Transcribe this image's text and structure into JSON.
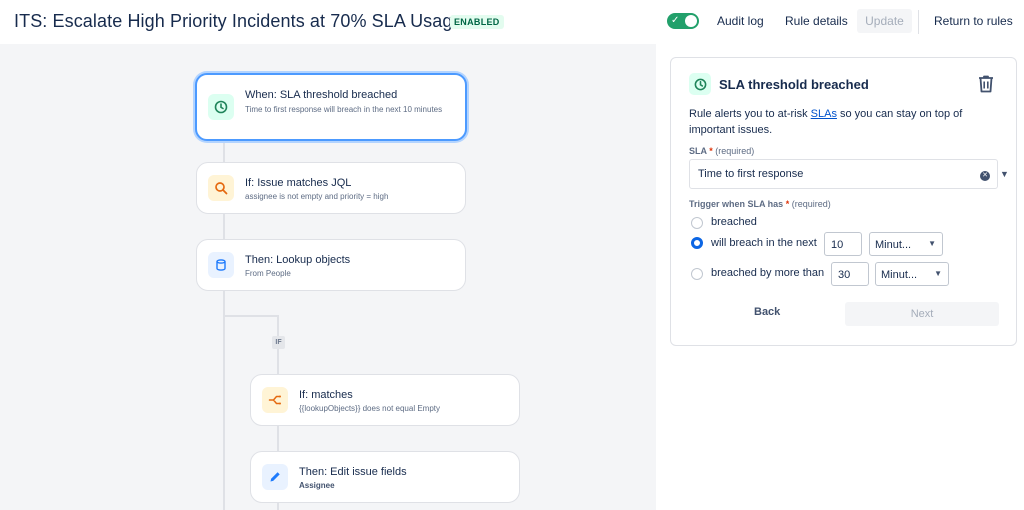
{
  "header": {
    "title": "ITS: Escalate High Priority Incidents at 70% SLA Usage",
    "status_badge": "ENABLED",
    "audit_log": "Audit log",
    "rule_details": "Rule details",
    "update": "Update",
    "return_to_rules": "Return to rules",
    "toggle_enabled": true
  },
  "flow": {
    "nodes": [
      {
        "title": "When: SLA threshold breached",
        "subtitle": "Time to first response will breach in the next 10 minutes",
        "icon": "clock-icon"
      },
      {
        "title": "If: Issue matches JQL",
        "subtitle": "assignee is not empty and priority = high",
        "icon": "search-icon"
      },
      {
        "title": "Then: Lookup objects",
        "subtitle": "From People",
        "icon": "database-icon"
      },
      {
        "title": "If: matches",
        "subtitle": "{{lookupObjects}} does not equal Empty",
        "icon": "branch-icon"
      },
      {
        "title": "Then: Edit issue fields",
        "subtitle": "Assignee",
        "icon": "pencil-icon"
      }
    ],
    "if_badge": "IF"
  },
  "panel": {
    "title": "SLA threshold breached",
    "description_before": "Rule alerts you to at-risk ",
    "description_link": "SLAs",
    "description_after": " so you can stay on top of important issues.",
    "sla_label": "SLA",
    "sla_required": "(required)",
    "sla_value": "Time to first response",
    "trigger_label": "Trigger when SLA has",
    "trigger_required": "(required)",
    "options": [
      {
        "label": "breached",
        "selected": false
      },
      {
        "label": "will breach in the next",
        "selected": true,
        "value": "10",
        "unit": "Minut..."
      },
      {
        "label": "breached by more than",
        "selected": false,
        "value": "30",
        "unit": "Minut..."
      }
    ],
    "back": "Back",
    "next": "Next"
  },
  "colors": {
    "accent": "#0c66e4",
    "toggle": "#22a06b",
    "selected_border": "#4c9aff"
  }
}
